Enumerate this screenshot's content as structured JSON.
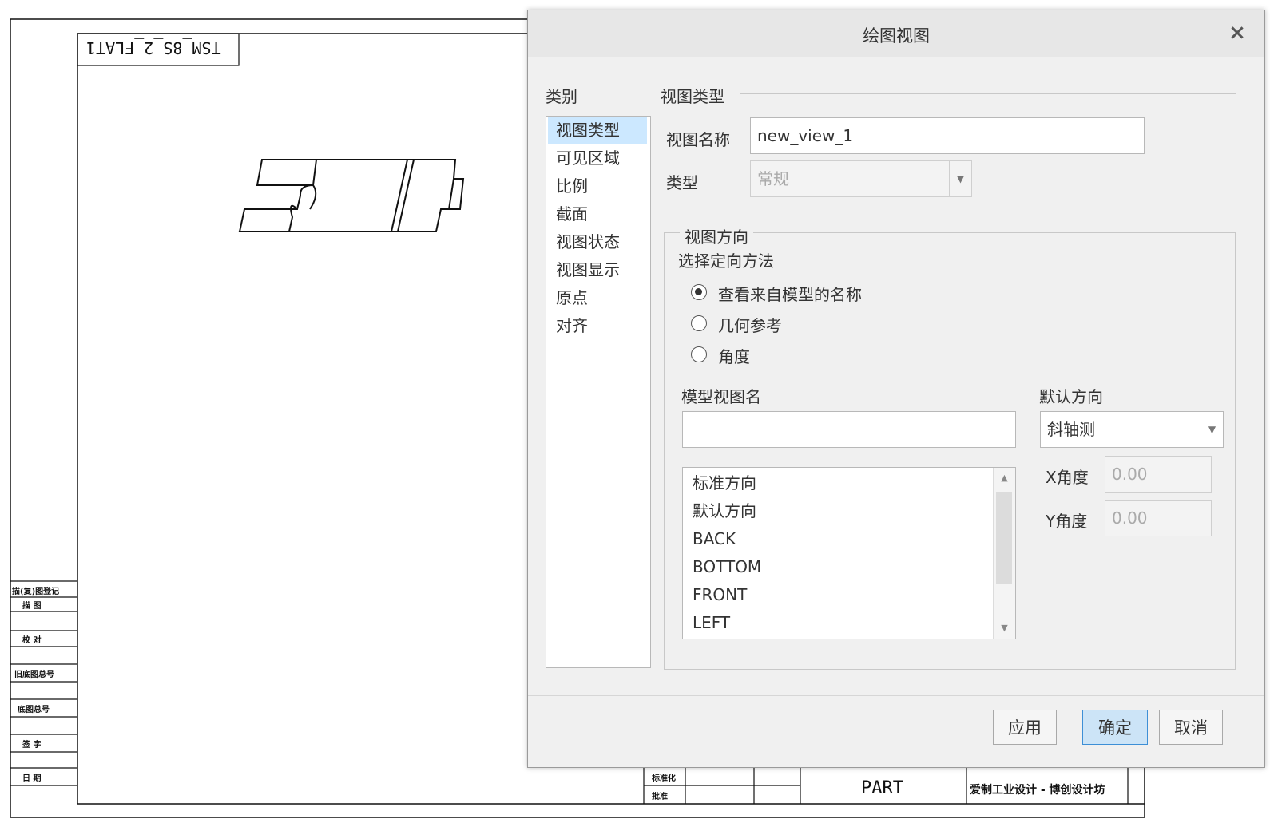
{
  "sheet": {
    "file_label": "TSM_8S_2_FLAT1",
    "part_label": "PART",
    "company_label": "爱制工业设计 - 博创设计坊",
    "revision_block_labels": [
      "描(复)图登记",
      "描 图",
      "校 对",
      "旧底图总号",
      "底图总号",
      "签 字",
      "日 期"
    ],
    "title_block_labels": [
      "标准化",
      "批准"
    ]
  },
  "dialog": {
    "title": "绘图视图",
    "close_icon": "×",
    "category_header": "类别",
    "categories": [
      "视图类型",
      "可见区域",
      "比例",
      "截面",
      "视图状态",
      "视图显示",
      "原点",
      "对齐"
    ],
    "selected_category": "视图类型",
    "section_title": "视图类型",
    "view_name_label": "视图名称",
    "view_name_value": "new_view_1",
    "type_label": "类型",
    "type_value": "常规",
    "orientation": {
      "group_title": "视图方向",
      "method_label": "选择定向方法",
      "options": [
        "查看来自模型的名称",
        "几何参考",
        "角度"
      ],
      "selected_option": "查看来自模型的名称",
      "model_view_name_label": "模型视图名",
      "model_view_name_value": "",
      "model_views": [
        "标准方向",
        "默认方向",
        "BACK",
        "BOTTOM",
        "FRONT",
        "LEFT"
      ],
      "default_orientation_label": "默认方向",
      "default_orientation_value": "斜轴测",
      "x_angle_label": "X角度",
      "x_angle_value": "0.00",
      "y_angle_label": "Y角度",
      "y_angle_value": "0.00"
    },
    "buttons": {
      "apply": "应用",
      "ok": "确定",
      "cancel": "取消"
    }
  },
  "colors": {
    "selection": "#cce8ff",
    "primary_button": "#cce4f7",
    "primary_border": "#3d8fd6"
  }
}
